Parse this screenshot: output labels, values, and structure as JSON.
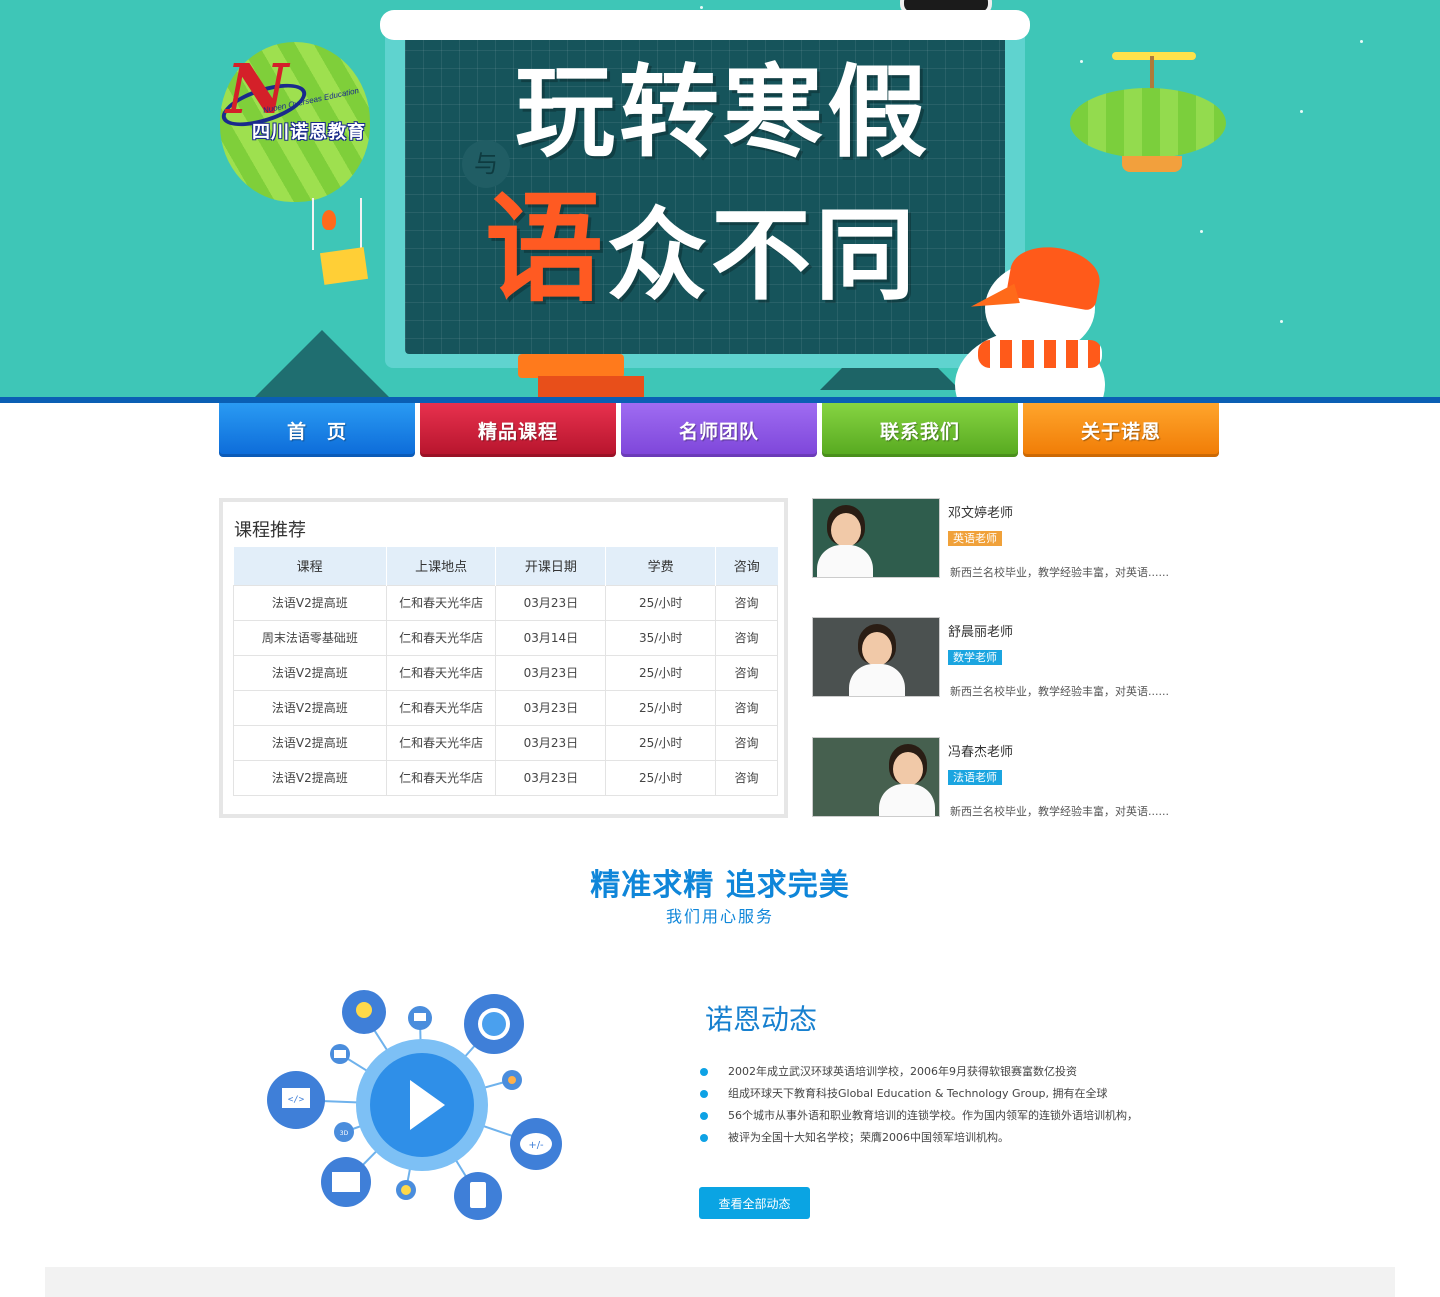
{
  "banner": {
    "title_line1": "玩转寒假",
    "title_line2_highlight": "语",
    "title_line2_rest": "众不同",
    "circle_glyph": "与",
    "logo_cn": "四川诺恩教育",
    "logo_en": "Nuoen Overseas Education",
    "logo_letter": "N"
  },
  "nav": {
    "items": [
      {
        "label": "首　页",
        "color_top": "#2a9bf3",
        "color_bottom": "#0c6ad8"
      },
      {
        "label": "精品课程",
        "color_top": "#e8314e",
        "color_bottom": "#b5142c"
      },
      {
        "label": "名师团队",
        "color_top": "#9f6cf2",
        "color_bottom": "#7d45d9"
      },
      {
        "label": "联系我们",
        "color_top": "#86d442",
        "color_bottom": "#56a81f"
      },
      {
        "label": "关于诺恩",
        "color_top": "#ffa52c",
        "color_bottom": "#f07b05"
      }
    ]
  },
  "courses": {
    "title": "课程推荐",
    "headers": [
      "课程",
      "上课地点",
      "开课日期",
      "学费",
      "咨询"
    ],
    "rows": [
      [
        "法语V2提高班",
        "仁和春天光华店",
        "03月23日",
        "25/小时",
        "咨询"
      ],
      [
        "周末法语零基础班",
        "仁和春天光华店",
        "03月14日",
        "35/小时",
        "咨询"
      ],
      [
        "法语V2提高班",
        "仁和春天光华店",
        "03月23日",
        "25/小时",
        "咨询"
      ],
      [
        "法语V2提高班",
        "仁和春天光华店",
        "03月23日",
        "25/小时",
        "咨询"
      ],
      [
        "法语V2提高班",
        "仁和春天光华店",
        "03月23日",
        "25/小时",
        "咨询"
      ],
      [
        "法语V2提高班",
        "仁和春天光华店",
        "03月23日",
        "25/小时",
        "咨询"
      ]
    ]
  },
  "teachers": [
    {
      "name": "邓文婷老师",
      "tag": "英语老师",
      "tag_color": "#f0a13a",
      "desc": "新西兰名校毕业，教学经验丰富，对英语......"
    },
    {
      "name": "舒晨丽老师",
      "tag": "数学老师",
      "tag_color": "#1ba5e0",
      "desc": "新西兰名校毕业，教学经验丰富，对英语......"
    },
    {
      "name": "冯春杰老师",
      "tag": "法语老师",
      "tag_color": "#1ba5e0",
      "desc": "新西兰名校毕业，教学经验丰富，对英语......"
    }
  ],
  "slogan": {
    "main": "精准求精  追求完美",
    "sub": "我们用心服务"
  },
  "network_icons": [
    "play-icon",
    "lightbulb-icon",
    "chat-icon",
    "globe-icon",
    "monitor-icon",
    "hand-icon",
    "cloud-math-icon",
    "book-icon",
    "phone-icon",
    "badge-icon",
    "message-icon"
  ],
  "network_labels": {
    "code": "</>",
    "math": "+/-",
    "badge": "3D"
  },
  "news": {
    "title": "诺恩动态",
    "items": [
      "2002年成立武汉环球英语培训学校，2006年9月获得软银赛富数亿投资",
      "组成环球天下教育科技Global Education & Technology Group, 拥有在全球",
      "56个城市从事外语和职业教育培训的连锁学校。作为国内领军的连锁外语培训机构，",
      "被评为全国十大知名学校；荣膺2006中国领军培训机构。"
    ],
    "button": "查看全部动态"
  }
}
